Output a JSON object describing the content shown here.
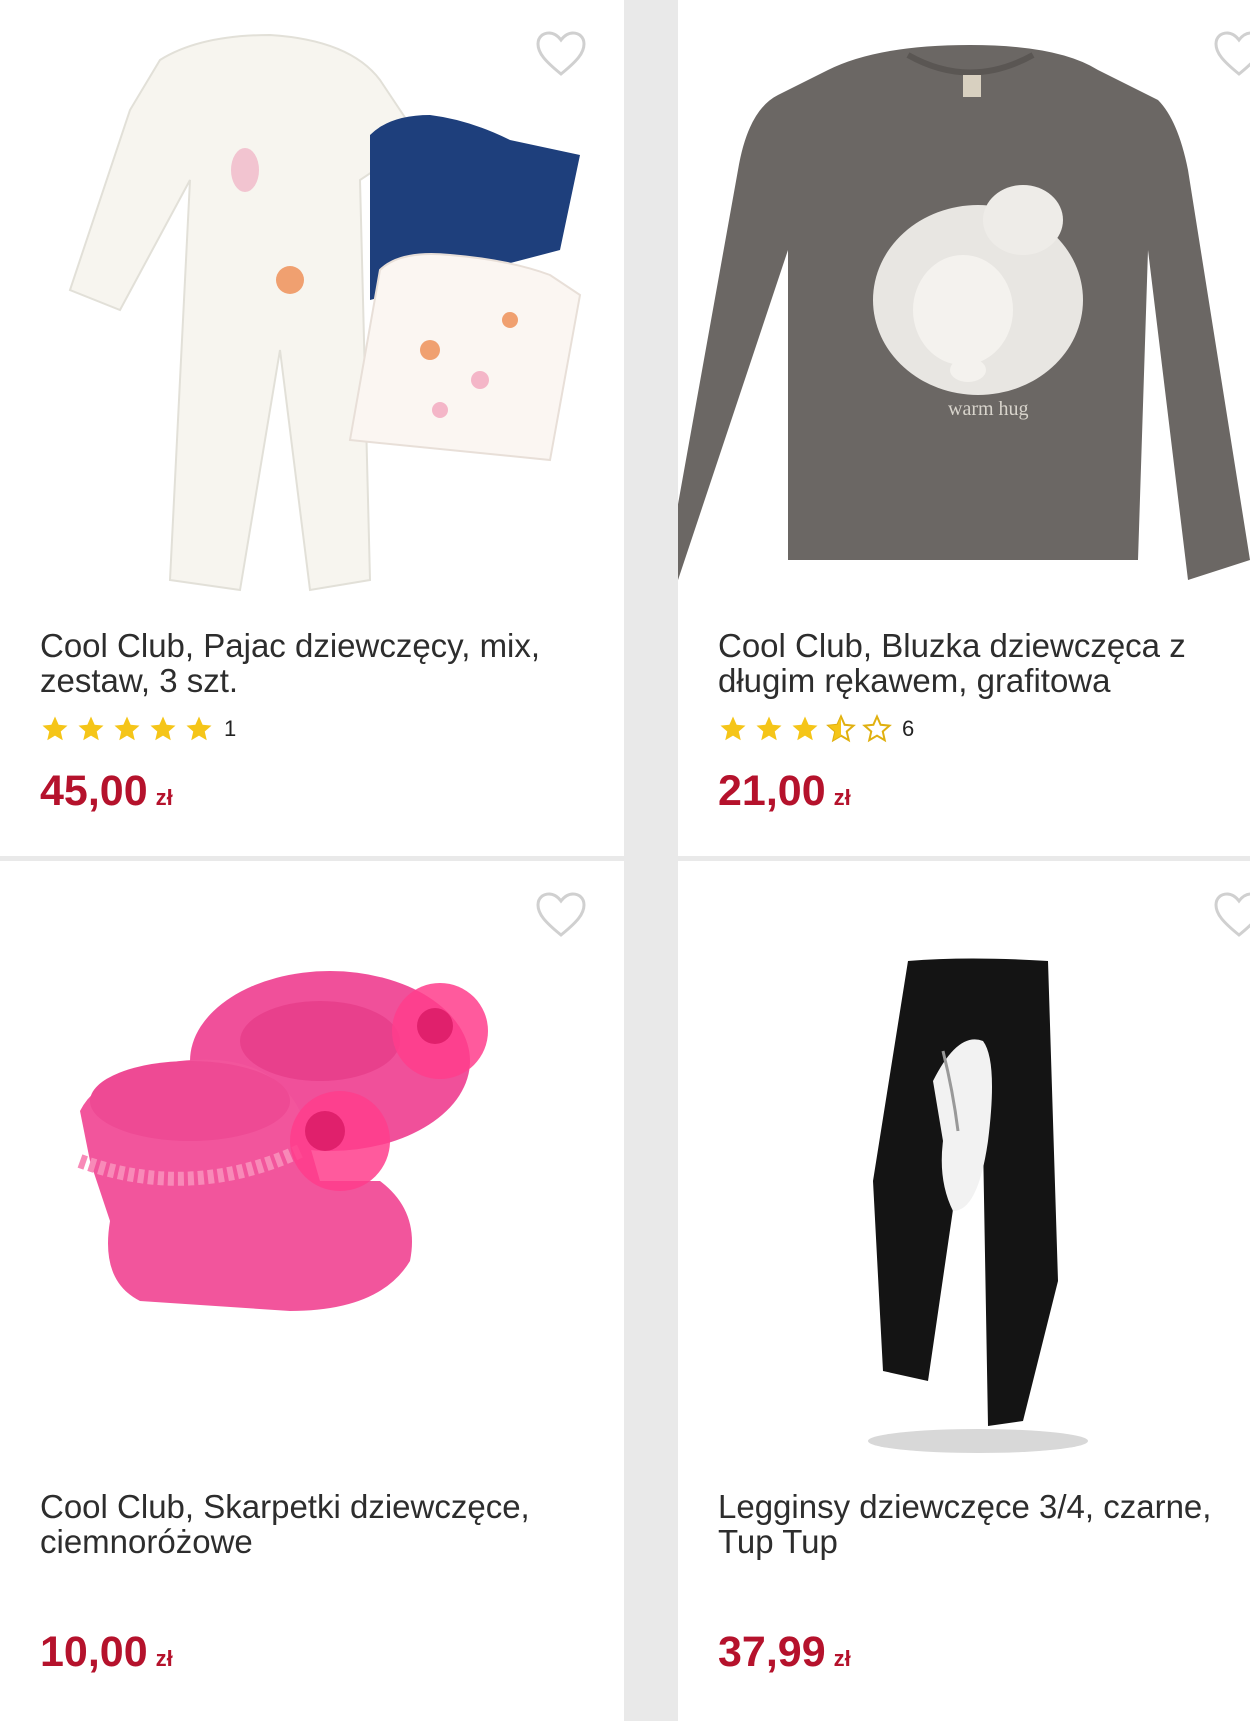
{
  "products": [
    {
      "title": "Cool Club, Pajac dziewczęcy, mix, zestaw, 3 szt.",
      "rating": 5,
      "rating_count": "1",
      "price": "45,00",
      "currency": "zł",
      "image_icon": "baby-onesie-set-image"
    },
    {
      "title": "Cool Club, Bluzka dziewczęca z długim rękawem, grafitowa",
      "rating": 3.5,
      "rating_count": "6",
      "price": "21,00",
      "currency": "zł",
      "image_icon": "grey-sweatshirt-image"
    },
    {
      "title": "Cool Club, Skarpetki dziewczęce, ciemnoróżowe",
      "price": "10,00",
      "currency": "zł",
      "image_icon": "pink-baby-socks-image"
    },
    {
      "title": "Legginsy dziewczęce 3/4, czarne, Tup Tup",
      "price": "37,99",
      "currency": "zł",
      "image_icon": "black-leggings-image"
    }
  ],
  "colors": {
    "price": "#b5122c",
    "star": "#f5c518",
    "heart_outline": "#d0d0d0"
  }
}
